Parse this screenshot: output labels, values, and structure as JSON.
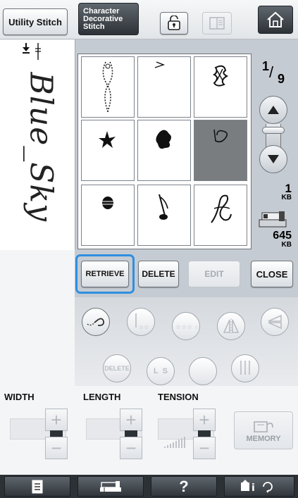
{
  "header": {
    "utility_label": "Utility Stitch",
    "character_line1": "Character",
    "character_line2": "Decorative",
    "character_line3": "Stitch"
  },
  "stitch_preview": {
    "handwriting": "Blue_Sky"
  },
  "pattern_grid": {
    "cells": [
      {
        "icon": "vertical-chain-pattern-icon",
        "selected": false
      },
      {
        "icon": "arrow-motif-icon",
        "selected": false
      },
      {
        "icon": "tangled-motif-icon",
        "selected": false
      },
      {
        "icon": "star-flower-icon",
        "selected": false
      },
      {
        "icon": "blob-motif-icon",
        "selected": false
      },
      {
        "icon": "script-letter-icon",
        "selected": true
      },
      {
        "icon": "round-dots-icon",
        "selected": false
      },
      {
        "icon": "music-note-icon",
        "selected": false
      },
      {
        "icon": "swirl-letter-icon",
        "selected": false
      }
    ]
  },
  "page": {
    "numerator": "1",
    "denominator": "9"
  },
  "memory_info": {
    "pattern_size": "1",
    "pattern_unit": "KB",
    "free_size": "645",
    "free_unit": "KB"
  },
  "actions": {
    "retrieve_label": "RETRIEVE",
    "delete_label": "DELETE",
    "edit_label": "EDIT",
    "close_label": "CLOSE"
  },
  "circle_controls": {
    "delete_label": "DELETE",
    "ls_label": "L  S"
  },
  "adjust": {
    "width_label": "WIDTH",
    "length_label": "LENGTH",
    "tension_label": "TENSION",
    "plus": "+",
    "minus": "−"
  },
  "memory_button": {
    "label": "MEMORY"
  },
  "bottom": {
    "help_label": "?"
  },
  "colors": {
    "highlight": "#2f8fe0",
    "panel": "#c5cbd2",
    "selected_cell": "#7a7d80"
  }
}
